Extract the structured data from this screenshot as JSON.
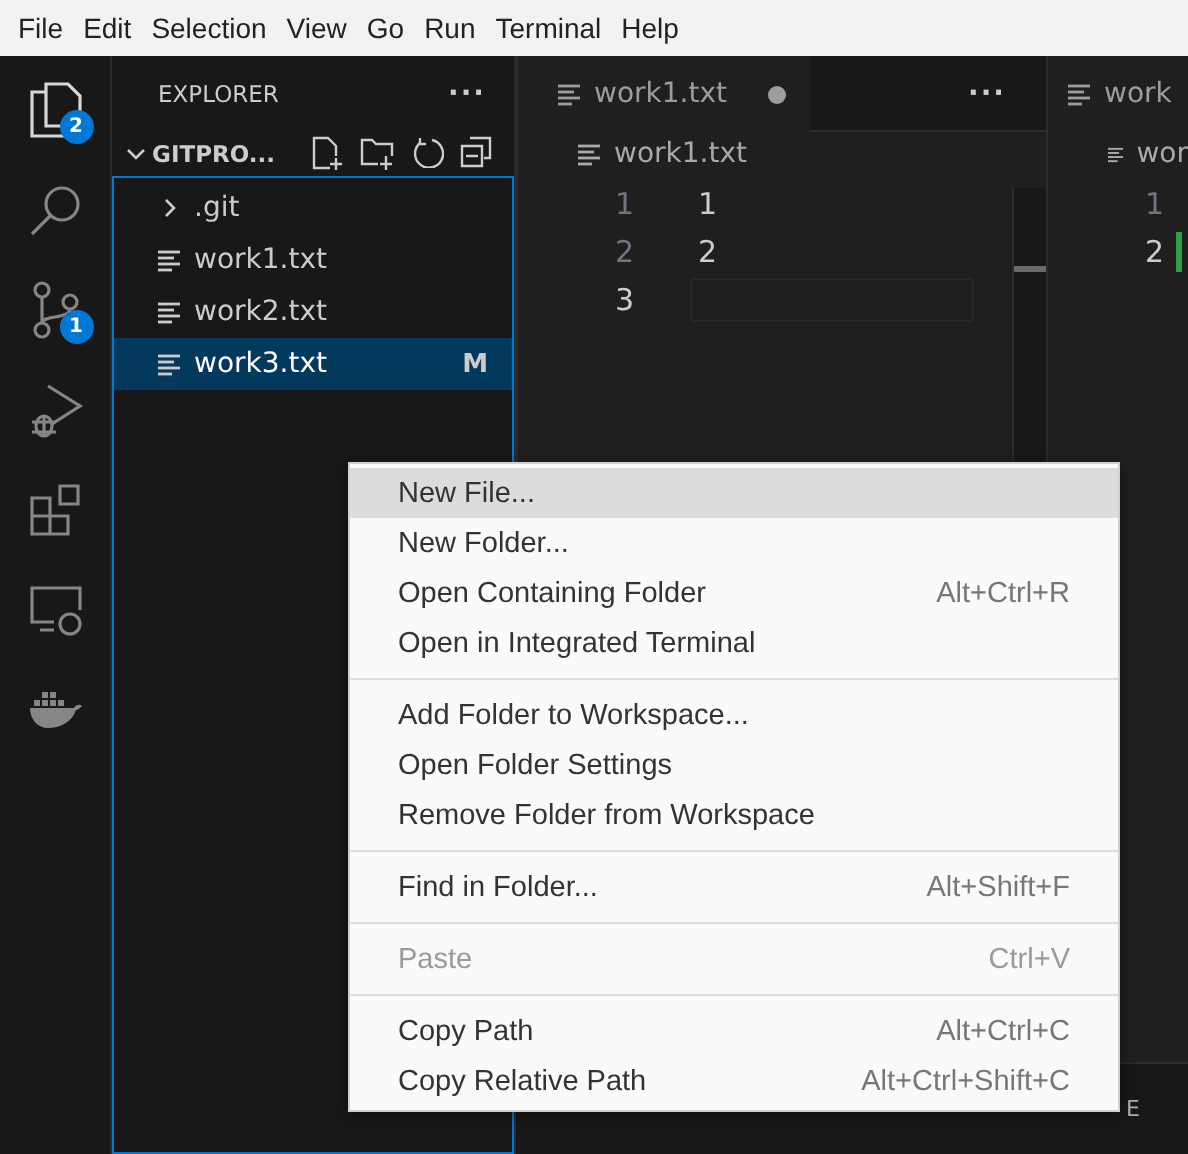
{
  "menu_bar": [
    "File",
    "Edit",
    "Selection",
    "View",
    "Go",
    "Run",
    "Terminal",
    "Help"
  ],
  "activity_bar": [
    {
      "kind": "files",
      "badge": "2",
      "selected": true
    },
    {
      "kind": "search",
      "selected": false
    },
    {
      "kind": "source-control",
      "badge": "1",
      "selected": false
    },
    {
      "kind": "run-debug",
      "selected": false
    },
    {
      "kind": "extensions",
      "selected": false
    },
    {
      "kind": "remote",
      "selected": false
    },
    {
      "kind": "docker",
      "selected": false
    }
  ],
  "sidebar": {
    "title": "EXPLORER",
    "more": "···",
    "folder": {
      "name": "GITPRO...",
      "expanded": true
    },
    "items": [
      {
        "kind": "folder",
        "name": ".git",
        "selected": false
      },
      {
        "kind": "file",
        "name": "work1.txt",
        "selected": false
      },
      {
        "kind": "file",
        "name": "work2.txt",
        "selected": false
      },
      {
        "kind": "file",
        "name": "work3.txt",
        "status": "M",
        "selected": true
      }
    ]
  },
  "editor_groups": [
    {
      "tab": {
        "label": "work1.txt",
        "dirty": true
      },
      "more": "···",
      "breadcrumb": "work1.txt",
      "lines": [
        {
          "number": "1",
          "text": "1",
          "current": false,
          "changed": false
        },
        {
          "number": "2",
          "text": "2",
          "current": false,
          "changed": false
        },
        {
          "number": "3",
          "current": true,
          "changed": false
        }
      ]
    },
    {
      "tab": {
        "label": "work"
      },
      "breadcrumb": "wor",
      "lines": [
        {
          "number": "1",
          "current": false,
          "changed": false
        },
        {
          "number": "2",
          "current": true,
          "changed": true
        }
      ]
    }
  ],
  "bottom_panel": {
    "label": "E"
  },
  "context_menu": [
    [
      {
        "label": "New File...",
        "selected": true,
        "disabled": false
      },
      {
        "label": "New Folder...",
        "selected": false,
        "disabled": false
      },
      {
        "label": "Open Containing Folder",
        "shortcut": "Alt+Ctrl+R",
        "selected": false,
        "disabled": false
      },
      {
        "label": "Open in Integrated Terminal",
        "selected": false,
        "disabled": false
      }
    ],
    [
      {
        "label": "Add Folder to Workspace...",
        "selected": false,
        "disabled": false
      },
      {
        "label": "Open Folder Settings",
        "selected": false,
        "disabled": false
      },
      {
        "label": "Remove Folder from Workspace",
        "selected": false,
        "disabled": false
      }
    ],
    [
      {
        "label": "Find in Folder...",
        "shortcut": "Alt+Shift+F",
        "selected": false,
        "disabled": false
      }
    ],
    [
      {
        "label": "Paste",
        "shortcut": "Ctrl+V",
        "selected": false,
        "disabled": true
      }
    ],
    [
      {
        "label": "Copy Path",
        "shortcut": "Alt+Ctrl+C",
        "selected": false,
        "disabled": false
      },
      {
        "label": "Copy Relative Path",
        "shortcut": "Alt+Ctrl+Shift+C",
        "selected": false,
        "disabled": false
      }
    ]
  ]
}
